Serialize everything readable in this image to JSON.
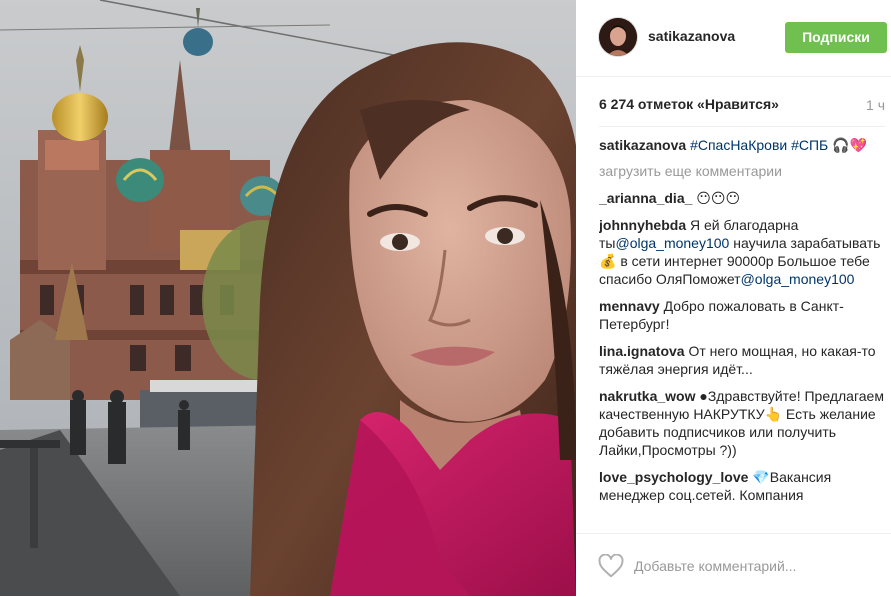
{
  "post": {
    "username": "satikazanova",
    "follow_label": "Подписки",
    "likes_text": "6 274 отметок «Нравится»",
    "time_ago": "1 ч"
  },
  "caption": {
    "user": "satikazanova",
    "text": "#СпасНаКрови #СПБ 🎧💖"
  },
  "load_more": "загрузить еще комментарии",
  "comments": [
    {
      "user": "_arianna_dia_",
      "text": "😶😶😶"
    },
    {
      "user": "johnnyhebda",
      "text_a": "Я ей благодарна ты",
      "mention_a": "@olga_money100",
      "text_b": " научила зарабатывать💰 в сети интернет 90000р Большое тебе спасибо ОляПоможет",
      "mention_b": "@olga_money100"
    },
    {
      "user": "mennavy",
      "text": "Добро пожаловать в Санкт-Петербург!"
    },
    {
      "user": "lina.ignatova",
      "text": "От него мощная, но какая-то тяжёлая энергия идёт..."
    },
    {
      "user": "nakrutka_wow",
      "text": "●Здравствуйте! Предлагаем качественную НАКРУТКУ👆 Есть желание добавить подписчиков или получить Лайки,Просмотры ?))"
    },
    {
      "user": "love_psychology_love",
      "text": "💎Вакансия менеджер соц.сетей. Компания"
    }
  ],
  "footer": {
    "comment_placeholder": "Добавьте комментарий..."
  },
  "icons": {
    "like": "heart-icon"
  },
  "colors": {
    "follow_button": "#70c050",
    "hashtag": "#003569",
    "muted": "#999999"
  }
}
